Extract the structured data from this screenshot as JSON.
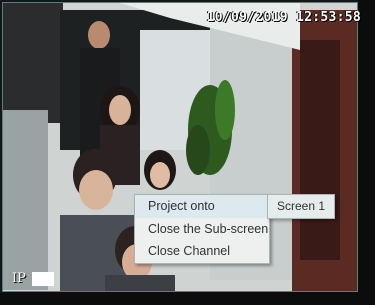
{
  "overlay": {
    "timestamp": "10/09/2019 12:53:58",
    "channel_prefix": "IP"
  },
  "context_menu": {
    "items": [
      {
        "label": "Project onto"
      },
      {
        "label": "Close the Sub-screen"
      },
      {
        "label": "Close Channel"
      }
    ]
  },
  "submenu": {
    "items": [
      {
        "label": "Screen 1"
      }
    ]
  },
  "colors": {
    "menu_bg": "#eef0f0",
    "menu_highlight": "#dde9ec",
    "border": "#a9b6b8",
    "timestamp_text": "#ffffff"
  }
}
